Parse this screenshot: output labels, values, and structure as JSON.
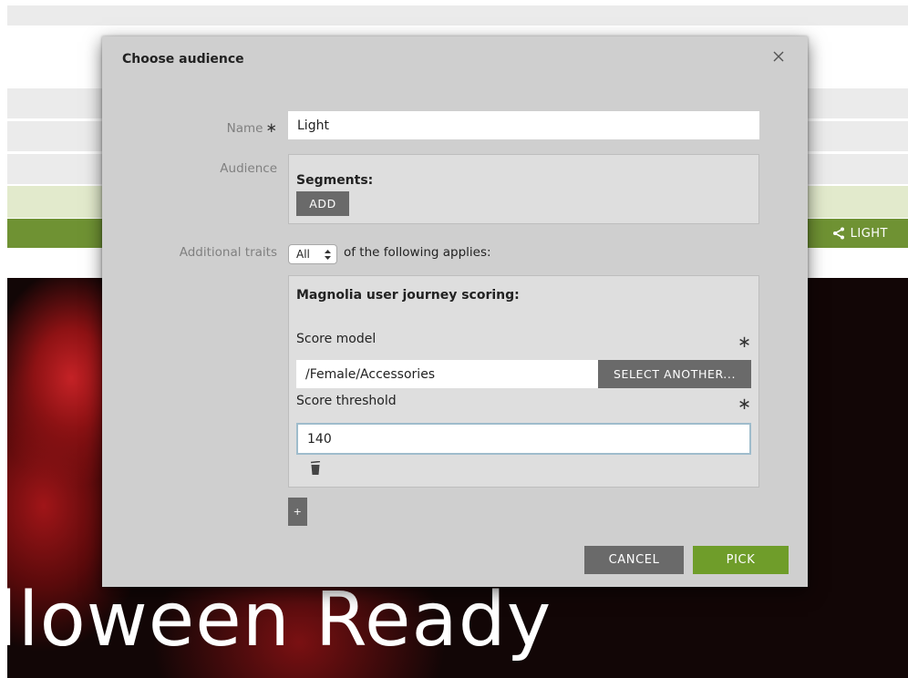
{
  "background": {
    "persona_label": "LIGHT",
    "hero_title": "lloween Ready"
  },
  "dialog": {
    "title": "Choose audience",
    "close_glyph": "×",
    "form": {
      "name_label": "Name",
      "required_mark": "∗",
      "name_value": "Light",
      "audience_label": "Audience",
      "segments_heading": "Segments:",
      "add_label": "ADD",
      "traits_label": "Additional traits",
      "traits_select_value": "All",
      "traits_suffix": "of the following applies:",
      "trait": {
        "heading": "Magnolia user journey scoring:",
        "score_model_label": "Score model",
        "score_model_value": "/Female/Accessories",
        "select_another_label": "SELECT ANOTHER...",
        "score_threshold_label": "Score threshold",
        "score_threshold_value": "140"
      },
      "add_trait_label": "+"
    },
    "footer": {
      "cancel_label": "CANCEL",
      "pick_label": "PICK"
    }
  },
  "colors": {
    "accent_green": "#6f9d2a",
    "dark_button": "#6a6a6a",
    "dialog_bg": "#cfcfcf"
  },
  "icons": [
    "close-icon",
    "share-icon",
    "trash-icon",
    "select-arrows-icon"
  ]
}
